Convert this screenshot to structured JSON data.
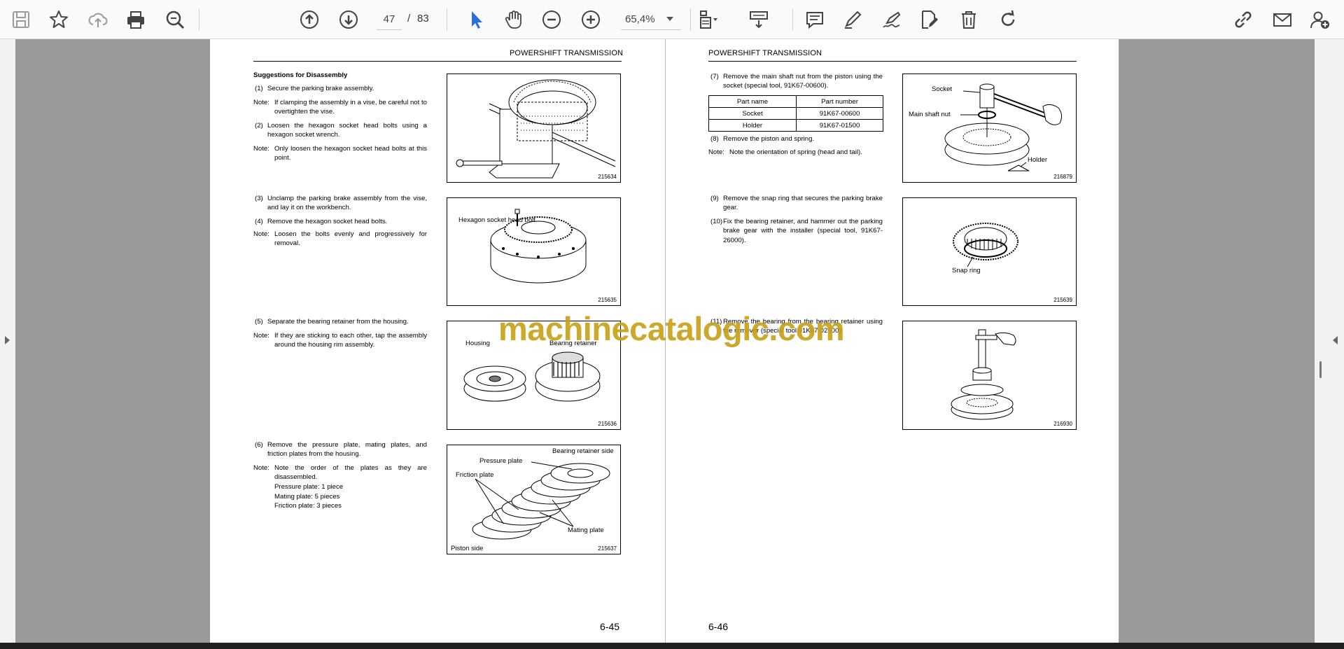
{
  "toolbar": {
    "buttons": [
      "save-icon",
      "star-icon",
      "cloud-upload-icon",
      "print-icon",
      "zoom-search-icon",
      "previous-page-icon",
      "next-page-icon",
      "select-cursor-icon",
      "hand-tool-icon",
      "zoom-out-icon",
      "zoom-in-icon",
      "page-layout-icon",
      "scroll-mode-icon",
      "comment-icon",
      "highlight-pen-icon",
      "sign-icon",
      "edit-document-icon",
      "delete-icon",
      "rotate-icon",
      "share-link-icon",
      "email-icon",
      "add-user-icon"
    ],
    "current_page": "47",
    "page_sep": "/",
    "total_pages": "83",
    "zoom": "65,4%",
    "accent_color": "#2a6fd6"
  },
  "watermark": "machinecatalogic.com",
  "left_page": {
    "header": "POWERSHIFT TRANSMISSION",
    "page_number": "6-45",
    "sec_title": "Suggestions for Disassembly",
    "steps": {
      "s1_n": "(1)",
      "s1": "Secure the parking brake assembly.",
      "n1_n": "Note:",
      "n1": "If clamping the assembly in a vise, be careful not to overtighten the vise.",
      "s2_n": "(2)",
      "s2": "Loosen the hexagon socket head bolts using a hexagon socket wrench.",
      "n2_n": "Note:",
      "n2": "Only loosen the hexagon socket head bolts at this point.",
      "s3_n": "(3)",
      "s3": "Unclamp the parking brake assembly from the vise, and lay it on the workbench.",
      "s4_n": "(4)",
      "s4": "Remove the hexagon socket head bolts.",
      "n4_n": "Note:",
      "n4": "Loosen the bolts evenly and progressively for removal.",
      "s5_n": "(5)",
      "s5": "Separate the bearing retainer from the housing.",
      "n5_n": "Note:",
      "n5": "If they are sticking to each other, tap the assembly around the housing rim assembly.",
      "s6_n": "(6)",
      "s6": "Remove the pressure plate, mating plates, and friction plates from the housing.",
      "n6_n": "Note:",
      "n6": "Note the order of the plates as they are disassembled.",
      "n6a": "Pressure plate: 1 piece",
      "n6b": "Mating plate: 5 pieces",
      "n6c": "Friction plate: 3 pieces"
    },
    "figures": {
      "f1_code": "215634",
      "f2_code": "215635",
      "f2_label": "Hexagon socket head bolt",
      "f3_code": "215636",
      "f3_housing": "Housing",
      "f3_retainer": "Bearing retainer",
      "f4_code": "215637",
      "f4_side": "Bearing retainer side",
      "f4_pressure": "Pressure plate",
      "f4_friction": "Friction plate",
      "f4_mating": "Mating plate",
      "f4_piston": "Piston side"
    }
  },
  "right_page": {
    "header": "POWERSHIFT TRANSMISSION",
    "page_number": "6-46",
    "steps": {
      "s7_n": "(7)",
      "s7": "Remove the main shaft nut from the piston using the socket (special tool, 91K67-00600).",
      "s8_n": "(8)",
      "s8": "Remove the piston and spring.",
      "n8_n": "Note:",
      "n8": "Note the orientation of spring (head and tail).",
      "s9_n": "(9)",
      "s9": "Remove the snap ring that secures the parking brake gear.",
      "s10_n": "(10)",
      "s10": "Fix the bearing retainer, and hammer out the parking brake gear with the installer (special tool, 91K67-26000).",
      "s11_n": "(11)",
      "s11": "Remove the bearing from the bearing retainer using the remover (special tool 91K67-02500)."
    },
    "parts_table": {
      "headers": [
        "Part name",
        "Part number"
      ],
      "rows": [
        [
          "Socket",
          "91K67-00600"
        ],
        [
          "Holder",
          "91K67-01500"
        ]
      ]
    },
    "figures": {
      "f5_code": "216879",
      "f5_socket": "Socket",
      "f5_nut": "Main shaft nut",
      "f5_holder": "Holder",
      "f6_code": "215639",
      "f6_ring": "Snap ring",
      "f7_code": "216930"
    }
  }
}
